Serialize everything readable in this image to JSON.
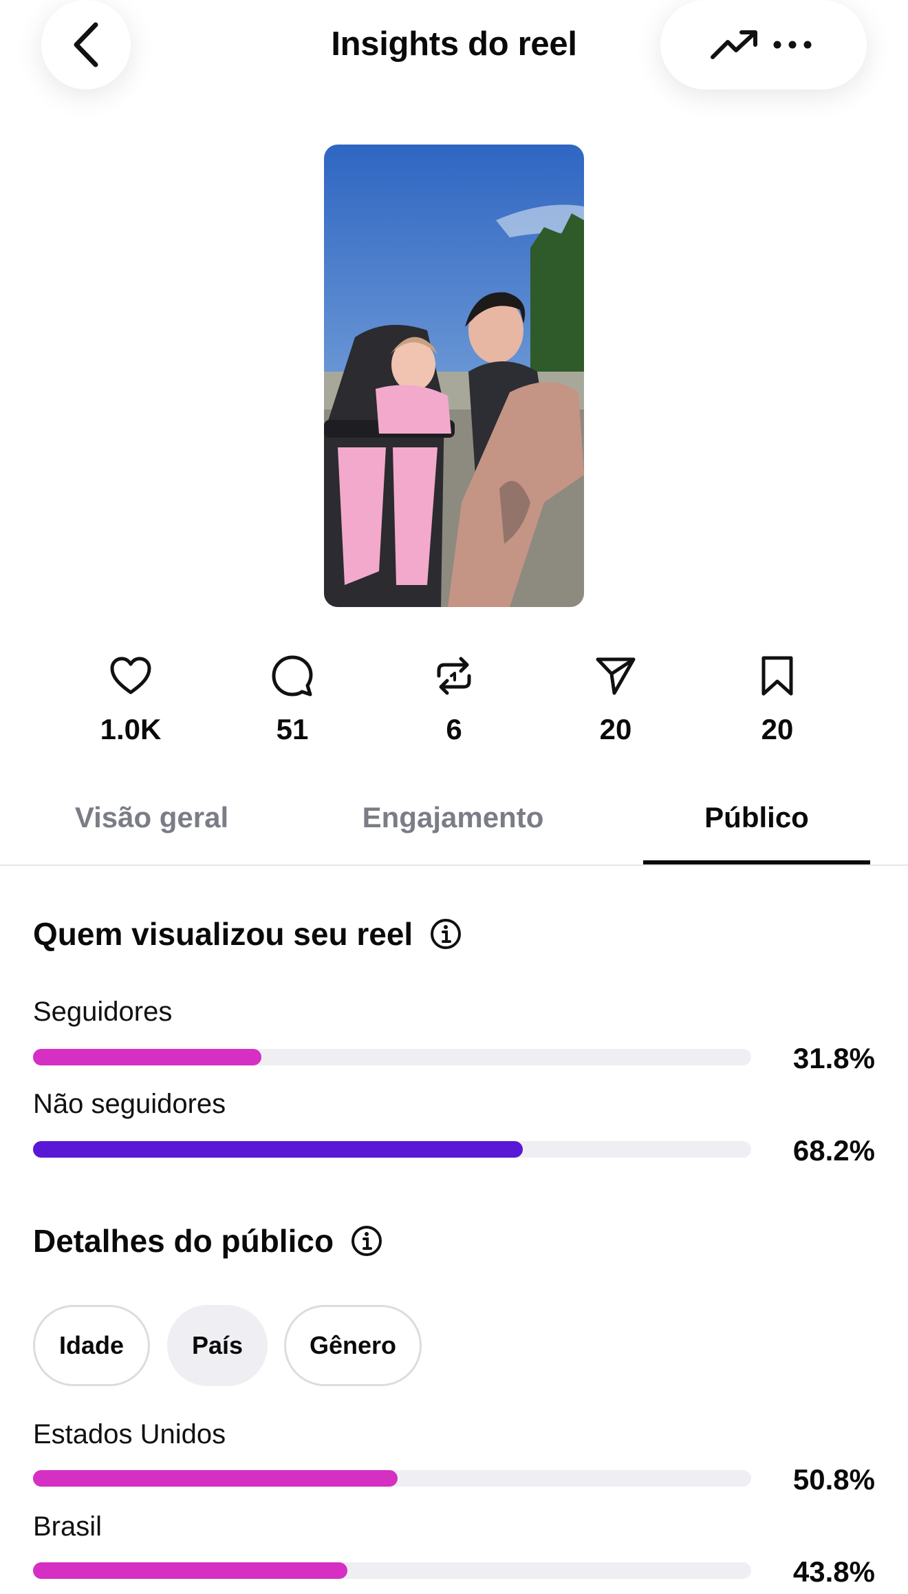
{
  "header": {
    "title": "Insights do reel"
  },
  "icons": {
    "back": "chevron-left-icon",
    "trend": "trending-up-icon",
    "more": "more-horizontal-icon",
    "like": "heart-icon",
    "comment": "comment-icon",
    "repost": "repost-icon",
    "share": "send-icon",
    "save": "bookmark-icon",
    "info": "info-icon"
  },
  "stats": [
    {
      "name": "likes",
      "value": "1.0K"
    },
    {
      "name": "comments",
      "value": "51"
    },
    {
      "name": "reposts",
      "value": "6"
    },
    {
      "name": "shares",
      "value": "20"
    },
    {
      "name": "saves",
      "value": "20"
    }
  ],
  "tabs": [
    {
      "label": "Visão geral",
      "active": false
    },
    {
      "label": "Engajamento",
      "active": false
    },
    {
      "label": "Público",
      "active": true
    }
  ],
  "viewers": {
    "title": "Quem visualizou seu reel",
    "items": [
      {
        "label": "Seguidores",
        "percent_text": "31.8%",
        "fraction": 0.318,
        "color": "#d52fc3"
      },
      {
        "label": "Não seguidores",
        "percent_text": "68.2%",
        "fraction": 0.682,
        "color": "#5a17d6"
      }
    ]
  },
  "audience": {
    "title": "Detalhes do público",
    "chips": [
      {
        "label": "Idade",
        "selected": false
      },
      {
        "label": "País",
        "selected": true
      },
      {
        "label": "Gênero",
        "selected": false
      }
    ],
    "items": [
      {
        "label": "Estados Unidos",
        "percent_text": "50.8%",
        "fraction": 0.508,
        "color": "#d52fc3"
      },
      {
        "label": "Brasil",
        "percent_text": "43.8%",
        "fraction": 0.438,
        "color": "#d52fc3"
      }
    ]
  }
}
